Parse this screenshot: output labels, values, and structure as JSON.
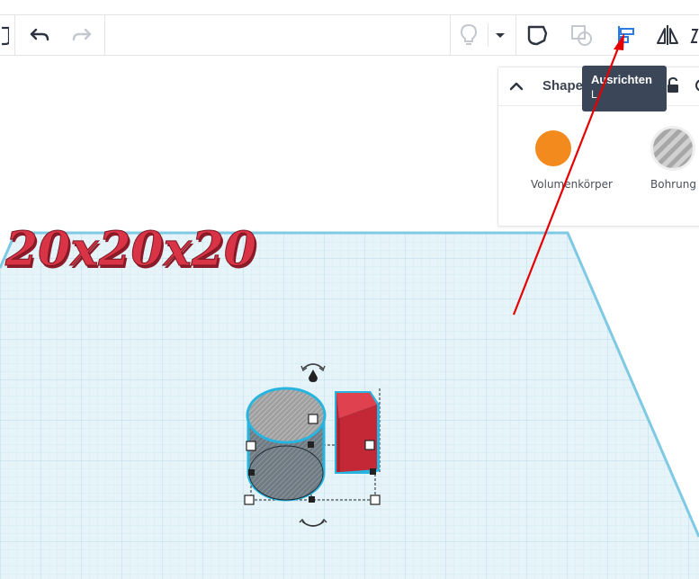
{
  "toolbar": {
    "undo_icon": "undo-icon",
    "redo_icon": "redo-icon",
    "partial_left_icon": "workplane-icon",
    "tools": [
      {
        "name": "light-bulb-icon"
      },
      {
        "name": "dropdown-icon"
      },
      {
        "name": "note-icon"
      },
      {
        "name": "duplicate-icon"
      },
      {
        "name": "align-icon"
      },
      {
        "name": "mirror-icon"
      }
    ]
  },
  "tooltip": {
    "title": "Ausrichten",
    "shortcut": "L"
  },
  "shape_panel": {
    "title": "Shape",
    "solid_label": "Volumenkörper",
    "hole_label": "Bohrung",
    "solid_color": "#f28a1e"
  },
  "scene": {
    "text_object": "20x20x20",
    "text_color": "#d93446",
    "box_color": "#d6303f",
    "cylinder_color": "#9c9c9c",
    "grid_color": "#cfe9f2",
    "plane_color": "#e3f3f8",
    "selection_color": "#27b5e0"
  },
  "annotation": {
    "arrow_color": "#e60000"
  }
}
